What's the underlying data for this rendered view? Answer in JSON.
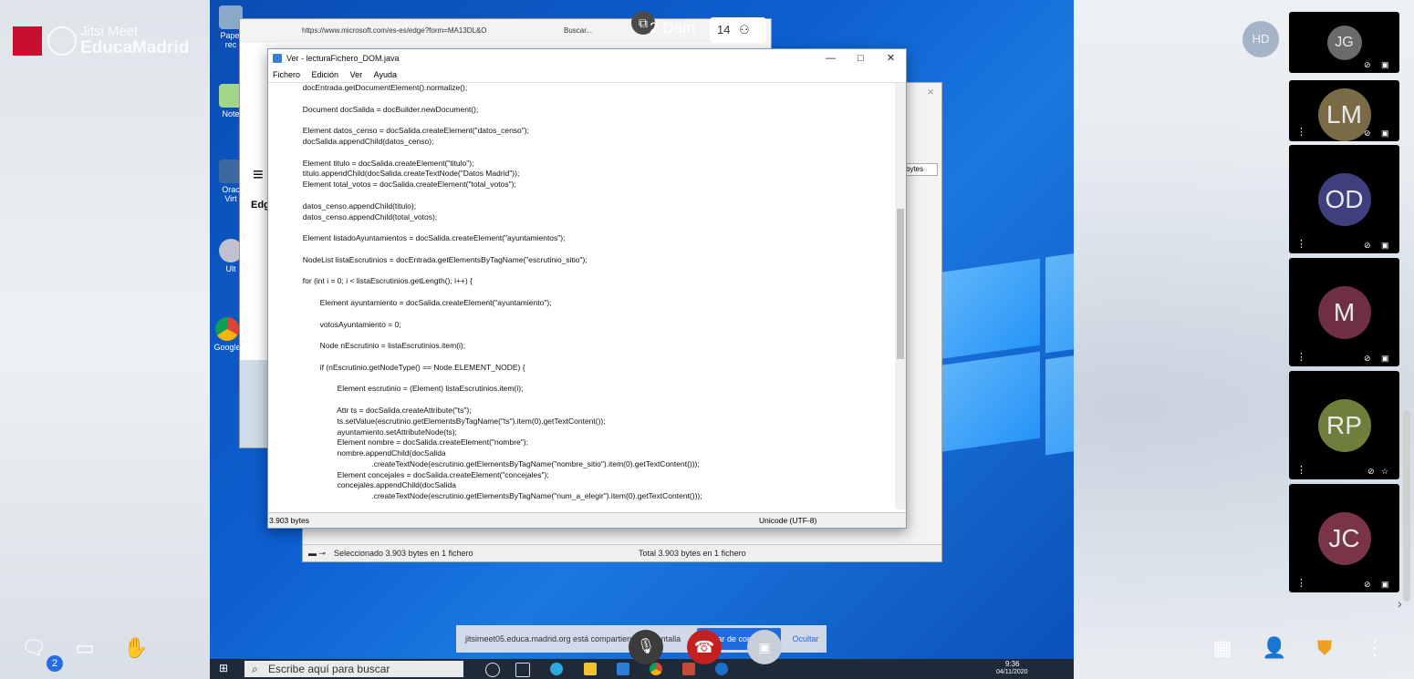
{
  "conference": {
    "brand_line1": "Jitsi Meet",
    "brand_line2": "EducaMadrid",
    "room_name": "2 Dam",
    "participant_count": "14",
    "local_avatar": "HD",
    "chat_unread": "2",
    "participants": [
      {
        "initials": "JG",
        "color": "#6b6b6b"
      },
      {
        "initials": "LM",
        "color": "#7a6a46"
      },
      {
        "initials": "OD",
        "color": "#3f3f7e"
      },
      {
        "initials": "M",
        "color": "#6e2f44"
      },
      {
        "initials": "RP",
        "color": "#6f7e3a"
      },
      {
        "initials": "JC",
        "color": "#7a3448"
      }
    ],
    "share_notice": "jitsimeet05.educa.madrid.org está compartiendo tu pantalla",
    "share_stop": "Dejar de compartir",
    "share_hide": "Ocultar",
    "icons": [
      "chat-icon",
      "screen-share-icon",
      "raise-hand-icon",
      "tile-view-icon",
      "invite-icon",
      "security-icon",
      "more-icon",
      "mic-off-icon",
      "hangup-icon",
      "camera-off-icon"
    ]
  },
  "desktop": {
    "icons": [
      "Papel rec",
      "Note",
      "Orac Virt",
      "Ult",
      "Google"
    ],
    "taskbar_search": "Escribe aquí para buscar",
    "clock_time": "9:36",
    "clock_date": "04/11/2020"
  },
  "edge": {
    "url": "https://www.microsoft.com/es-es/edge?form=MA13DL&O",
    "search_placeholder": "Buscar...",
    "tab_label": "Edg"
  },
  "infowin": {
    "status_left": "Seleccionado 3.903 bytes en 1 fichero",
    "status_right": "Total 3.903 bytes en 1 fichero",
    "bytes_label": "bytes"
  },
  "notepad": {
    "title": "Ver - lecturaFichero_DOM.java",
    "menu": [
      "Fichero",
      "Edición",
      "Ver",
      "Ayuda"
    ],
    "status_left": "3.903 bytes",
    "status_right": "Unicode (UTF-8)",
    "code": "                docEntrada.getDocumentElement().normalize();\n\n                Document docSalida = docBuilder.newDocument();\n\n                Element datos_censo = docSalida.createElement(\"datos_censo\");\n                docSalida.appendChild(datos_censo);\n\n                Element titulo = docSalida.createElement(\"titulo\");\n                titulo.appendChild(docSalida.createTextNode(\"Datos Madrid\"));\n                Element total_votos = docSalida.createElement(\"total_votos\");\n\n                datos_censo.appendChild(titulo);\n                datos_censo.appendChild(total_votos);\n\n                Element listadoAyuntamientos = docSalida.createElement(\"ayuntamientos\");\n\n                NodeList listaEscrutinios = docEntrada.getElementsByTagName(\"escrutinio_sitio\");\n\n                for (int i = 0; i < listaEscrutinios.getLength(); i++) {\n\n                        Element ayuntamiento = docSalida.createElement(\"ayuntamiento\");\n\n                        votosAyuntamiento = 0;\n\n                        Node nEscrutinio = listaEscrutinios.item(i);\n\n                        if (nEscrutinio.getNodeType() == Node.ELEMENT_NODE) {\n\n                                Element escrutinio = (Element) listaEscrutinios.item(i);\n\n                                Attr ts = docSalida.createAttribute(\"ts\");\n                                ts.setValue(escrutinio.getElementsByTagName(\"ts\").item(0).getTextContent());\n                                ayuntamiento.setAttributeNode(ts);\n                                Element nombre = docSalida.createElement(\"nombre\");\n                                nombre.appendChild(docSalida\n                                                .createTextNode(escrutinio.getElementsByTagName(\"nombre_sitio\").item(0).getTextContent()));\n                                Element concejales = docSalida.createElement(\"concejales\");\n                                concejales.appendChild(docSalida\n                                                .createTextNode(escrutinio.getElementsByTagName(\"num_a_elegir\").item(0).getTextContent()));"
  }
}
